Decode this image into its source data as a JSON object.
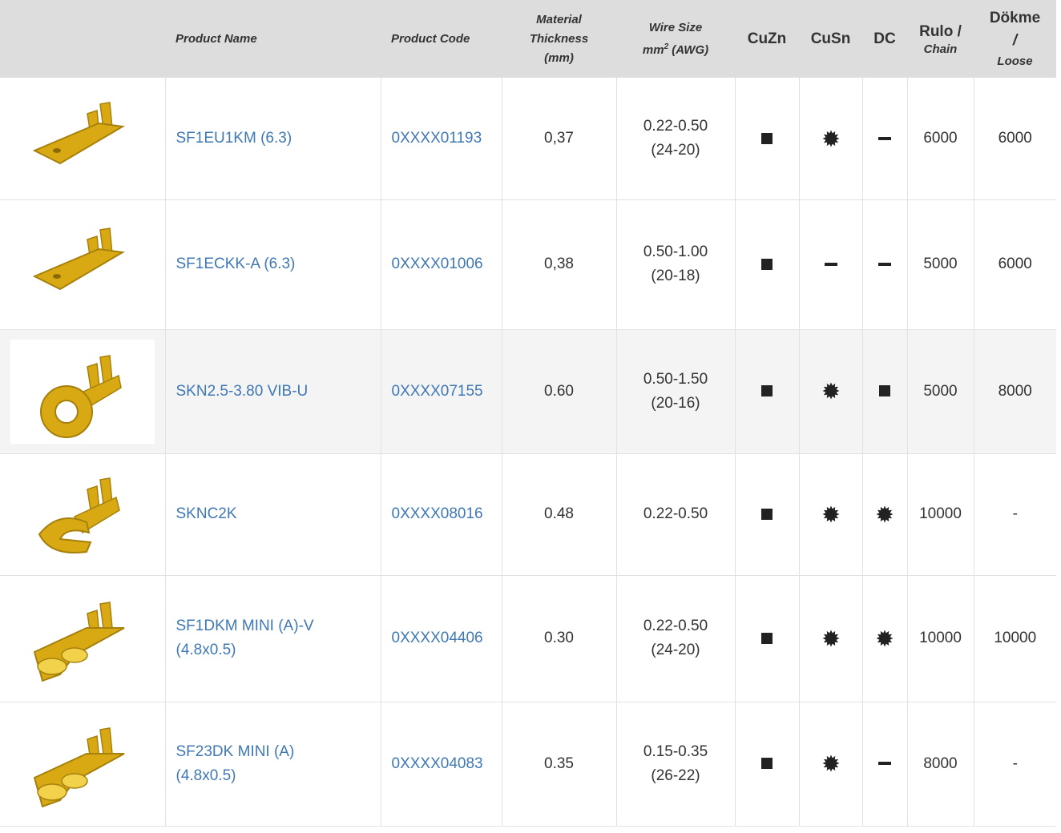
{
  "header": {
    "product_name": "Product Name",
    "product_code": "Product Code",
    "material_thickness": [
      "Material",
      "Thickness",
      "(mm)"
    ],
    "wire_size": [
      "Wire Size",
      "mm",
      "2",
      " (AWG)"
    ],
    "cuzn": "CuZn",
    "cusn": "CuSn",
    "dc": "DC",
    "rulo": [
      "Rulo /",
      "Chain"
    ],
    "dokme": [
      "Dökme",
      "/",
      "Loose"
    ]
  },
  "colors": {
    "link": "#3f78b4",
    "header_bg": "#dddddd",
    "alt_row": "#f4f4f4",
    "terminal": "#d9a914"
  },
  "rows": [
    {
      "image_icon": "flat-male-terminal",
      "name": [
        "SF1EU1KM (6.3)"
      ],
      "code": "0XXXX01193",
      "thickness": "0,37",
      "wire": [
        "0.22-0.50",
        "(24-20)"
      ],
      "cuzn": "square",
      "cusn": "star",
      "dc": "dash",
      "rulo": "6000",
      "dokme": "6000"
    },
    {
      "image_icon": "flat-male-terminal",
      "name": [
        "SF1ECKK-A (6.3)"
      ],
      "code": "0XXXX01006",
      "thickness": "0,38",
      "wire": [
        "0.50-1.00",
        "(20-18)"
      ],
      "cuzn": "square",
      "cusn": "dash",
      "dc": "dash",
      "rulo": "5000",
      "dokme": "6000"
    },
    {
      "image_icon": "ring-terminal",
      "name": [
        "SKN2.5-3.80 VIB-U"
      ],
      "code": "0XXXX07155",
      "thickness": "0.60",
      "wire": [
        "0.50-1.50",
        "(20-16)"
      ],
      "cuzn": "square",
      "cusn": "star",
      "dc": "square",
      "rulo": "5000",
      "dokme": "8000"
    },
    {
      "image_icon": "fork-terminal",
      "name": [
        "SKNC2K"
      ],
      "code": "0XXXX08016",
      "thickness": "0.48",
      "wire": [
        "0.22-0.50"
      ],
      "cuzn": "square",
      "cusn": "star",
      "dc": "star",
      "rulo": "10000",
      "dokme": "-"
    },
    {
      "image_icon": "female-receptacle-terminal",
      "name": [
        "SF1DKM MINI (A)-V",
        "(4.8x0.5)"
      ],
      "code": "0XXXX04406",
      "thickness": "0.30",
      "wire": [
        "0.22-0.50",
        "(24-20)"
      ],
      "cuzn": "square",
      "cusn": "star",
      "dc": "star",
      "rulo": "10000",
      "dokme": "10000"
    },
    {
      "image_icon": "female-receptacle-terminal",
      "name": [
        "SF23DK MINI (A)",
        "(4.8x0.5)"
      ],
      "code": "0XXXX04083",
      "thickness": "0.35",
      "wire": [
        "0.15-0.35",
        "(26-22)"
      ],
      "cuzn": "square",
      "cusn": "star",
      "dc": "dash",
      "rulo": "8000",
      "dokme": "-"
    }
  ]
}
